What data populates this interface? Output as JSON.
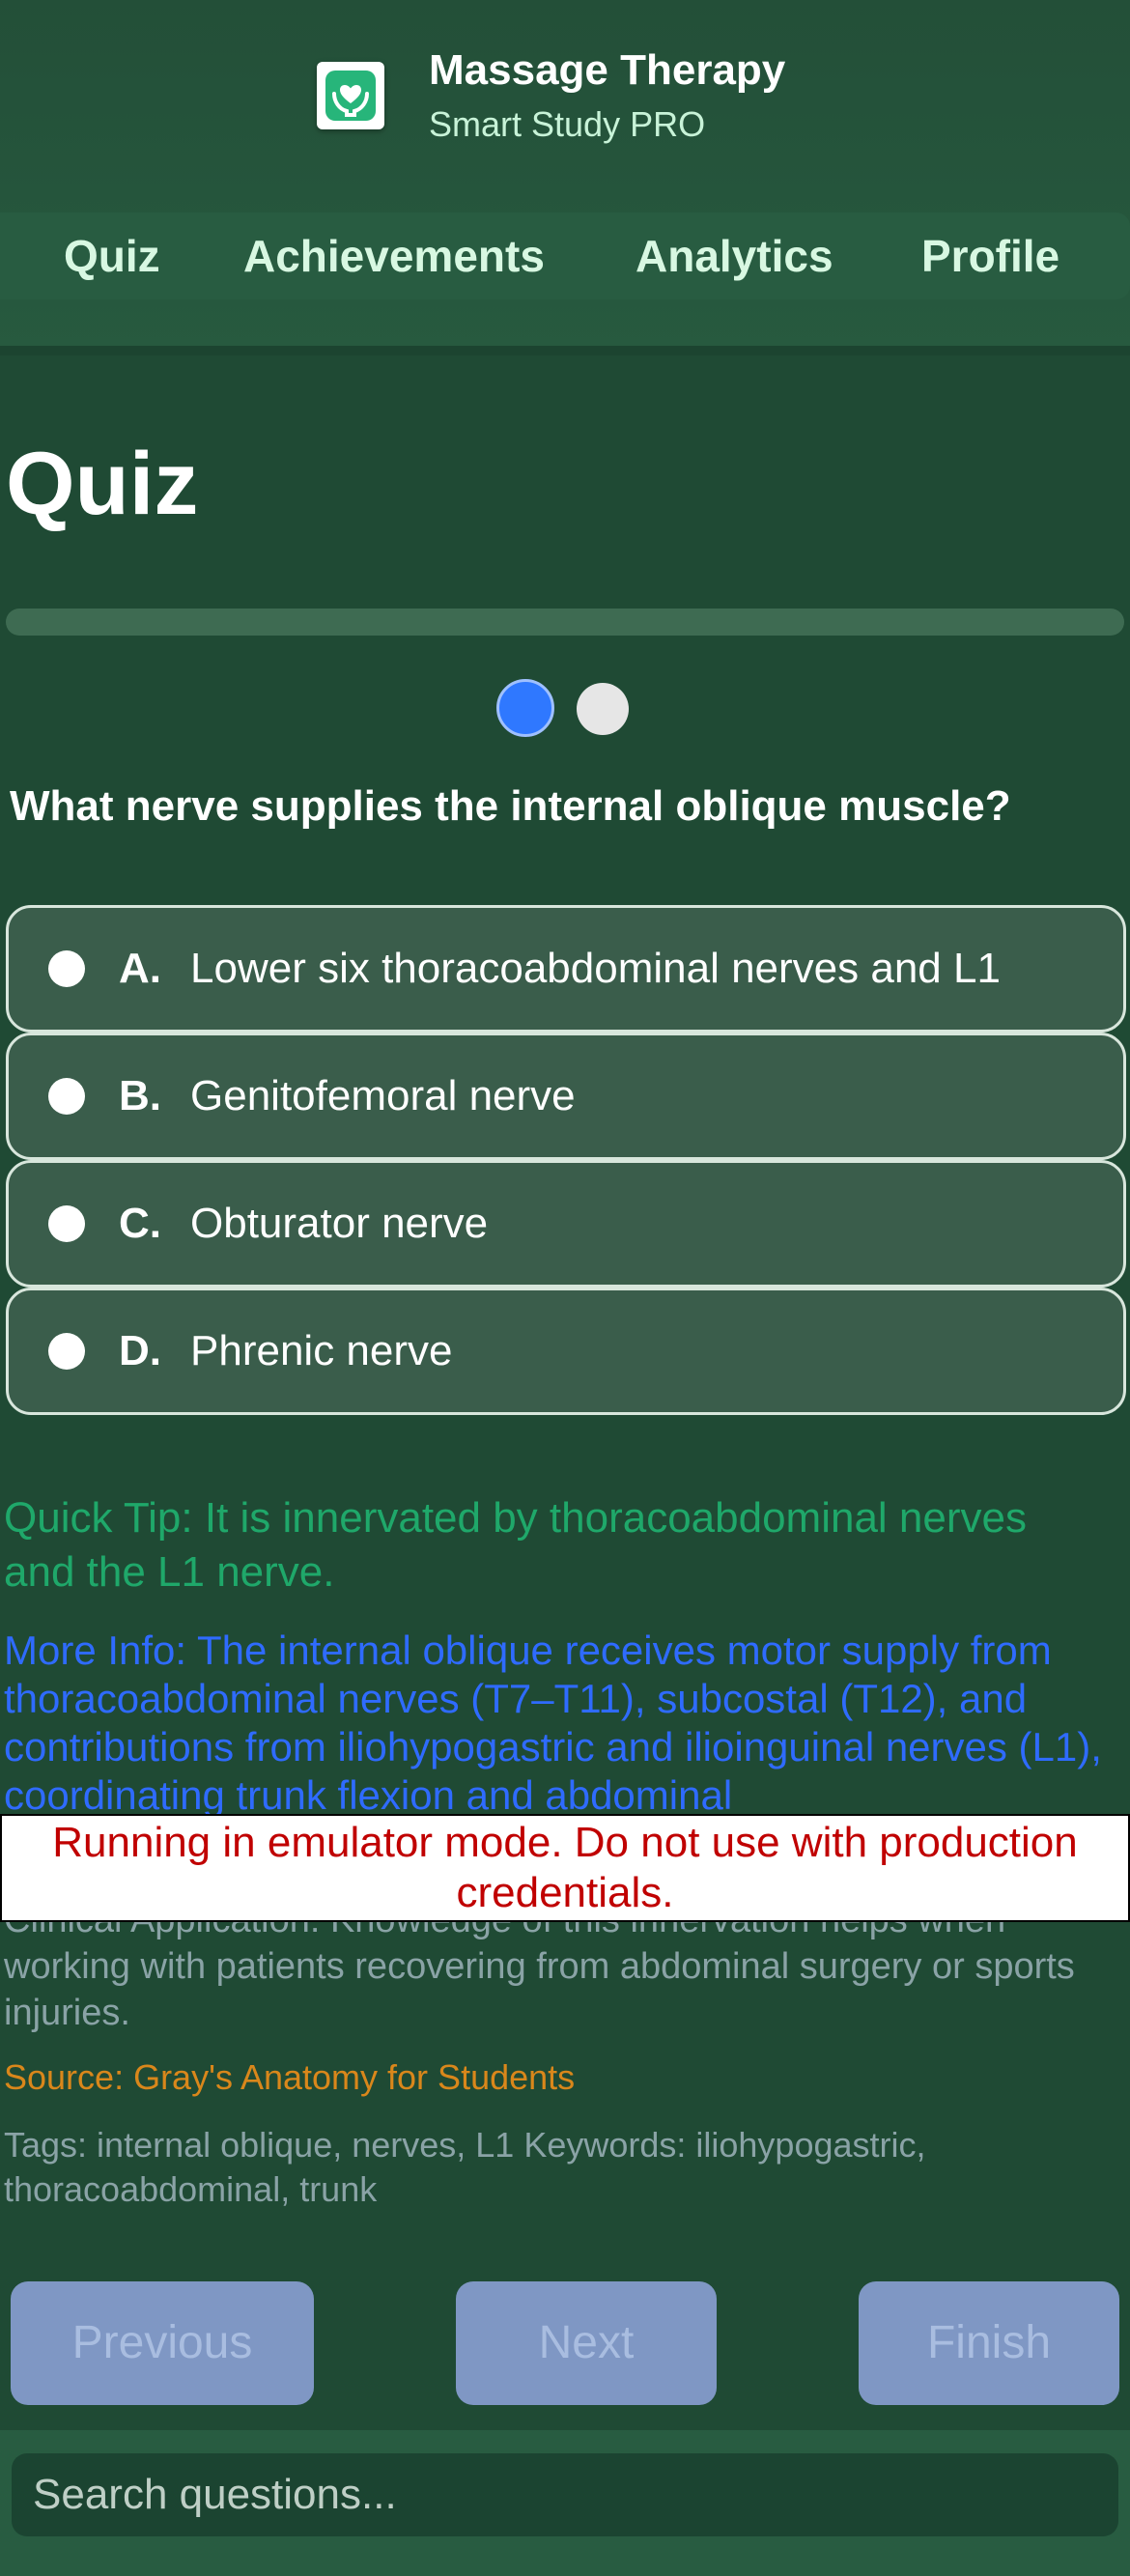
{
  "app": {
    "title": "Massage Therapy",
    "subtitle": "Smart Study PRO",
    "logo_icon": "hands-heart-icon"
  },
  "nav": {
    "tabs": [
      {
        "label": "Quiz"
      },
      {
        "label": "Achievements"
      },
      {
        "label": "Analytics"
      },
      {
        "label": "Profile"
      }
    ]
  },
  "quiz": {
    "title": "Quiz",
    "progress_fraction": 0.0,
    "step_indicator": {
      "current": 1,
      "total": 2
    },
    "question": "What nerve supplies the internal oblique muscle?",
    "options": [
      {
        "letter": "A.",
        "text": "Lower six thoracoabdominal nerves and L1"
      },
      {
        "letter": "B.",
        "text": "Genitofemoral nerve"
      },
      {
        "letter": "C.",
        "text": "Obturator nerve"
      },
      {
        "letter": "D.",
        "text": "Phrenic nerve"
      }
    ],
    "quick_tip": "Quick Tip: It is innervated by thoracoabdominal nerves and the L1 nerve.",
    "more_info": "More Info: The internal oblique receives motor supply from thoracoabdominal nerves (T7–T11), subcostal (T12), and contributions from iliohypogastric and ilioinguinal nerves (L1), coordinating trunk flexion and abdominal",
    "clinical_application": "Clinical Application: Knowledge of this innervation helps when working with patients recovering from abdominal surgery or sports injuries.",
    "source": "Source: Gray's Anatomy for Students",
    "tags": "Tags: internal oblique, nerves, L1 Keywords: iliohypogastric, thoracoabdominal, trunk"
  },
  "banner": {
    "text": "Running in emulator mode. Do not use with production credentials."
  },
  "buttons": {
    "previous": "Previous",
    "next": "Next",
    "finish": "Finish"
  },
  "search": {
    "placeholder": "Search questions..."
  },
  "colors": {
    "background": "#1f4a34",
    "accent_blue": "#2f78ff",
    "tip_green": "#1fa86a",
    "source_orange": "#d9871b",
    "banner_red": "#c00000"
  }
}
